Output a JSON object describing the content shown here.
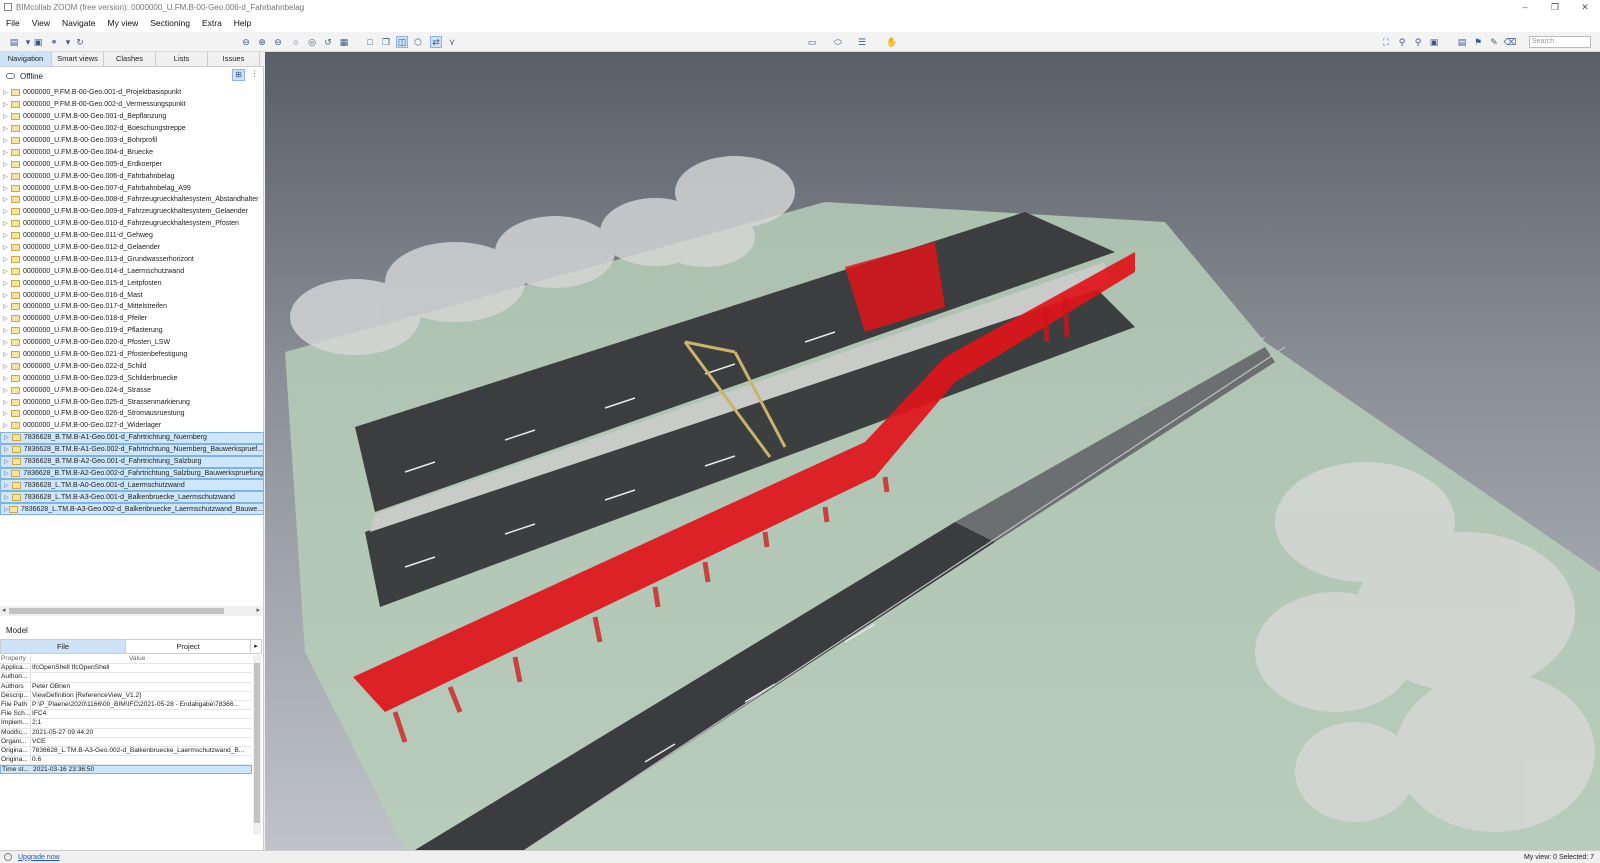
{
  "window": {
    "title": "BIMcollab ZOOM (free version): 0000000_U.FM.B-00-Geo.006-d_Fahrbahnbelag",
    "controls": [
      "–",
      "❐",
      "✕"
    ]
  },
  "menu": [
    "File",
    "View",
    "Navigate",
    "My view",
    "Sectioning",
    "Extra",
    "Help"
  ],
  "toolbar": {
    "search_placeholder": "Search"
  },
  "left_panel": {
    "tabs": [
      "Navigation",
      "Smart views",
      "Clashes",
      "Lists",
      "Issues"
    ],
    "active_tab": "Navigation",
    "status": "Offline",
    "tree": [
      {
        "label": "0000000_P.FM.B-00-Geo.001-d_Projektbasispunkt",
        "selected": false
      },
      {
        "label": "0000000_P.FM.B-00-Geo.002-d_Vermessungspunkt",
        "selected": false
      },
      {
        "label": "0000000_U.FM.B-00-Geo.001-d_Bepflanzung",
        "selected": false
      },
      {
        "label": "0000000_U.FM.B-00-Geo.002-d_Boeschungstreppe",
        "selected": false
      },
      {
        "label": "0000000_U.FM.B-00-Geo.003-d_Bohrprofil",
        "selected": false
      },
      {
        "label": "0000000_U.FM.B-00-Geo.004-d_Bruecke",
        "selected": false
      },
      {
        "label": "0000000_U.FM.B-00-Geo.005-d_Erdkoerper",
        "selected": false
      },
      {
        "label": "0000000_U.FM.B-00-Geo.006-d_Fahrbahnbelag",
        "selected": false
      },
      {
        "label": "0000000_U.FM.B-00-Geo.007-d_Fahrbahnbelag_A99",
        "selected": false
      },
      {
        "label": "0000000_U.FM.B-00-Geo.008-d_Fahrzeugrueckhaltesystem_Abstandhalter",
        "selected": false
      },
      {
        "label": "0000000_U.FM.B-00-Geo.009-d_Fahrzeugrueckhaltesystem_Gelaender",
        "selected": false
      },
      {
        "label": "0000000_U.FM.B-00-Geo.010-d_Fahrzeugrueckhaltesystem_Pfosten",
        "selected": false
      },
      {
        "label": "0000000_U.FM.B-00-Geo.011-d_Gehweg",
        "selected": false
      },
      {
        "label": "0000000_U.FM.B-00-Geo.012-d_Gelaender",
        "selected": false
      },
      {
        "label": "0000000_U.FM.B-00-Geo.013-d_Grundwasserhorizont",
        "selected": false
      },
      {
        "label": "0000000_U.FM.B-00-Geo.014-d_Laermschutzwand",
        "selected": false
      },
      {
        "label": "0000000_U.FM.B-00-Geo.015-d_Leitpfosten",
        "selected": false
      },
      {
        "label": "0000000_U.FM.B-00-Geo.016-d_Mast",
        "selected": false
      },
      {
        "label": "0000000_U.FM.B-00-Geo.017-d_Mittelstreifen",
        "selected": false
      },
      {
        "label": "0000000_U.FM.B-00-Geo.018-d_Pfeiler",
        "selected": false
      },
      {
        "label": "0000000_U.FM.B-00-Geo.019-d_Pflasterung",
        "selected": false
      },
      {
        "label": "0000000_U.FM.B-00-Geo.020-d_Pfosten_LSW",
        "selected": false
      },
      {
        "label": "0000000_U.FM.B-00-Geo.021-d_Pfostenbefestigung",
        "selected": false
      },
      {
        "label": "0000000_U.FM.B-00-Geo.022-d_Schild",
        "selected": false
      },
      {
        "label": "0000000_U.FM.B-00-Geo.023-d_Schilderbruecke",
        "selected": false
      },
      {
        "label": "0000000_U.FM.B-00-Geo.024-d_Strasse",
        "selected": false
      },
      {
        "label": "0000000_U.FM.B-00-Geo.025-d_Strassenmarkierung",
        "selected": false
      },
      {
        "label": "0000000_U.FM.B-00-Geo.026-d_Stromausruestung",
        "selected": false
      },
      {
        "label": "0000000_U.FM.B-00-Geo.027-d_Widerlager",
        "selected": false
      },
      {
        "label": "7836628_B.TM.B-A1-Geo.001-d_Fahrtrichtung_Nuernberg",
        "selected": true
      },
      {
        "label": "7836628_B.TM.B-A1-Geo.002-d_Fahrtrichtung_Nuernberg_Bauwerkspruef...",
        "selected": true
      },
      {
        "label": "7836628_B.TM.B-A2-Geo.001-d_Fahrtrichtung_Salzburg",
        "selected": true
      },
      {
        "label": "7836628_B.TM.B-A2-Geo.002-d_Fahrtrichtung_Salzburg_Bauwerkspruefung",
        "selected": true
      },
      {
        "label": "7836628_L.TM.B-A0-Geo.001-d_Laermschutzwand",
        "selected": true
      },
      {
        "label": "7836628_L.TM.B-A3-Geo.001-d_Balkenbruecke_Laermschutzwand",
        "selected": true
      },
      {
        "label": "7836628_L.TM.B-A3-Geo.002-d_Balkenbruecke_Laermschutzwand_Bauwe...",
        "selected": true
      }
    ]
  },
  "properties": {
    "title": "Model",
    "tabs": [
      "File",
      "Project"
    ],
    "active_tab": "File",
    "header": {
      "key": "Property",
      "value": "Value"
    },
    "rows": [
      {
        "key": "Applica...",
        "value": "IfcOpenShell IfcOpenShell",
        "selected": false
      },
      {
        "key": "Authori...",
        "value": "",
        "selected": false
      },
      {
        "key": "Authors",
        "value": "Peter OBrien",
        "selected": false
      },
      {
        "key": "Descrip...",
        "value": "ViewDefinition [ReferenceView_V1.2]",
        "selected": false
      },
      {
        "key": "File Path",
        "value": "P:\\P_Plaene\\2020\\1166\\00_BIM\\IFC\\2021-05-28 - Endabgabe\\78366...",
        "selected": false
      },
      {
        "key": "File Sch...",
        "value": "IFC4",
        "selected": false
      },
      {
        "key": "Implem...",
        "value": "2;1",
        "selected": false
      },
      {
        "key": "Modific...",
        "value": "2021-05-27 09:44:20",
        "selected": false
      },
      {
        "key": "Organi...",
        "value": "VCE",
        "selected": false
      },
      {
        "key": "Origina...",
        "value": "7836628_L.TM.B-A3-Geo.002-d_Balkenbruecke_Laermschutzwand_B...",
        "selected": false
      },
      {
        "key": "Origina...",
        "value": "0.6",
        "selected": false
      },
      {
        "key": "Time st...",
        "value": "2021-03-16 23:36:50",
        "selected": true
      }
    ]
  },
  "statusbar": {
    "upgrade_link": "Upgrade now",
    "right_text": "My view: 0   Selected: 7"
  },
  "colors": {
    "selection": "#cde6fb",
    "highlight_red": "#e0141a",
    "terrain": "#b5cdb6"
  }
}
